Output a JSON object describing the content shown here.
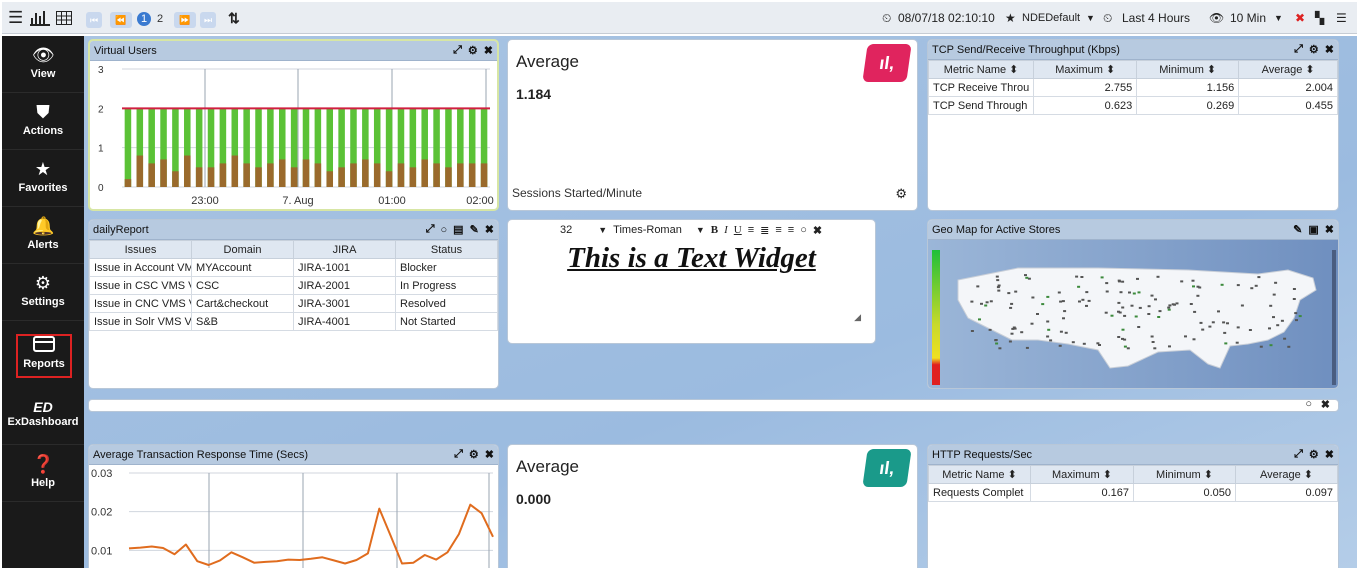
{
  "toolbar": {
    "page_1": "1",
    "page_2": "2",
    "datetime": "08/07/18 02:10:10",
    "profile": "NDEDefault",
    "range": "Last 4 Hours",
    "interval": "10 Min",
    "icons": [
      "hamburger-icon",
      "bar-chart-icon",
      "grid-icon",
      "first-page-icon",
      "prev-page-icon",
      "next-page-icon",
      "last-page-icon",
      "sort-icon",
      "clock-icon",
      "star-icon",
      "clock-icon",
      "eye-icon",
      "pin-icon",
      "layout-icon",
      "list-icon"
    ]
  },
  "sidebar": {
    "items": [
      {
        "label": "View",
        "icon": "eye-icon"
      },
      {
        "label": "Actions",
        "icon": "shield-icon"
      },
      {
        "label": "Favorites",
        "icon": "star-icon"
      },
      {
        "label": "Alerts",
        "icon": "bell-icon"
      },
      {
        "label": "Settings",
        "icon": "gear-icon"
      },
      {
        "label": "Reports",
        "icon": "card-icon"
      },
      {
        "label": "ExDashboard",
        "icon": "ed-icon",
        "glyph": "ED"
      },
      {
        "label": "Help",
        "icon": "help-icon"
      }
    ]
  },
  "virtual_users": {
    "title": "Virtual Users"
  },
  "average1": {
    "title": "Average",
    "value": "1.184",
    "footer": "Sessions Started/Minute",
    "logo_color": "#e0245e"
  },
  "tcp": {
    "title": "TCP Send/Receive Throughput (Kbps)",
    "headers": [
      "Metric Name",
      "Maximum",
      "Minimum",
      "Average"
    ],
    "rows": [
      [
        "TCP Receive Throu",
        "2.755",
        "1.156",
        "2.004"
      ],
      [
        "TCP Send Through",
        "0.623",
        "0.269",
        "0.455"
      ]
    ]
  },
  "daily_report": {
    "title": "dailyReport",
    "headers": [
      "Issues",
      "Domain",
      "JIRA",
      "Status"
    ],
    "rows": [
      [
        "Issue in Account VM",
        "MYAccount",
        "JIRA-1001",
        "Blocker"
      ],
      [
        "Issue in CSC VMS V",
        "CSC",
        "JIRA-2001",
        "In Progress"
      ],
      [
        "Issue in CNC VMS V",
        "Cart&checkout",
        "JIRA-3001",
        "Resolved"
      ],
      [
        "Issue in Solr VMS V",
        "S&B",
        "JIRA-4001",
        "Not Started"
      ]
    ]
  },
  "text_widget": {
    "font_size": "32",
    "font_family": "Times-Roman",
    "text": "This is a Text Widget"
  },
  "geo_map": {
    "title": "Geo Map for Active Stores"
  },
  "art": {
    "title": "Average Transaction Response Time (Secs)"
  },
  "average2": {
    "title": "Average",
    "value": "0.000",
    "logo_color": "#1a9a8a"
  },
  "http": {
    "title": "HTTP Requests/Sec",
    "headers": [
      "Metric Name",
      "Maximum",
      "Minimum",
      "Average"
    ],
    "rows": [
      [
        "Requests Complet",
        "0.167",
        "0.050",
        "0.097"
      ]
    ]
  },
  "chart_data": [
    {
      "type": "bar",
      "title": "Virtual Users",
      "x_tick_labels": [
        "23:00",
        "7. Aug",
        "01:00",
        "02:00"
      ],
      "y_tick_labels": [
        "0",
        "1",
        "2",
        "3"
      ],
      "ylim": [
        0,
        3
      ],
      "series": [
        {
          "color": "#5bc236",
          "values": [
            2,
            2,
            2,
            2,
            2,
            2,
            2,
            2,
            2,
            2,
            2,
            2,
            2,
            2,
            2,
            2,
            2,
            2,
            2,
            2,
            2,
            2,
            2,
            2,
            2,
            2,
            2,
            2,
            2,
            2,
            2
          ]
        },
        {
          "color": "#9a6a2c",
          "values": [
            0.2,
            0.8,
            0.6,
            0.7,
            0.4,
            0.8,
            0.5,
            0.5,
            0.6,
            0.8,
            0.6,
            0.5,
            0.6,
            0.7,
            0.5,
            0.7,
            0.6,
            0.4,
            0.5,
            0.6,
            0.7,
            0.6,
            0.4,
            0.6,
            0.5,
            0.7,
            0.6,
            0.5,
            0.6,
            0.6,
            0.6
          ]
        }
      ],
      "reference_line": {
        "value": 2,
        "color": "#d02040"
      }
    },
    {
      "type": "line",
      "title": "Average Transaction Response Time (Secs)",
      "y_tick_labels": [
        "0.01",
        "0.02",
        "0.03"
      ],
      "ylim": [
        0,
        0.03
      ],
      "series": [
        {
          "color": "#e06c1e",
          "values": [
            0.0105,
            0.0107,
            0.011,
            0.0106,
            0.009,
            0.0115,
            0.0072,
            0.0062,
            0.0074,
            0.0095,
            0.0082,
            0.0068,
            0.007,
            0.0072,
            0.0076,
            0.0075,
            0.0078,
            0.0082,
            0.0074,
            0.0066,
            0.0075,
            0.0092,
            0.0208,
            0.0138,
            0.0066,
            0.0068,
            0.0088,
            0.0076,
            0.0095,
            0.0142,
            0.0218,
            0.0196,
            0.0135
          ]
        }
      ]
    }
  ]
}
